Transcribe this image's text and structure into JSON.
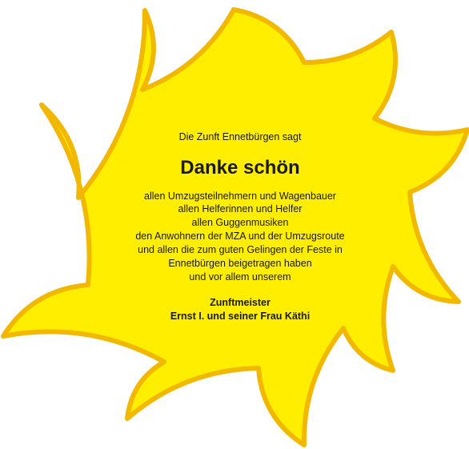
{
  "colors": {
    "sun_fill": "#FFEE00",
    "sun_outline": "#F2B800",
    "text": "#1a1a1a"
  },
  "card": {
    "intro": "Die Zunft Ennetbürgen sagt",
    "title": "Danke schön",
    "lines": [
      "allen Umzugsteilnehmern und Wagenbauer",
      "allen Helferinnen und Helfer",
      "allen Guggenmusiken",
      "den Anwohnern der MZA und der Umzugsroute",
      "und allen die zum guten Gelingen der Feste in",
      "Ennetbürgen beigetragen haben",
      "und vor allem unserem"
    ],
    "closing": [
      "Zunftmeister",
      "Ernst I. und seiner Frau Käthi"
    ]
  }
}
